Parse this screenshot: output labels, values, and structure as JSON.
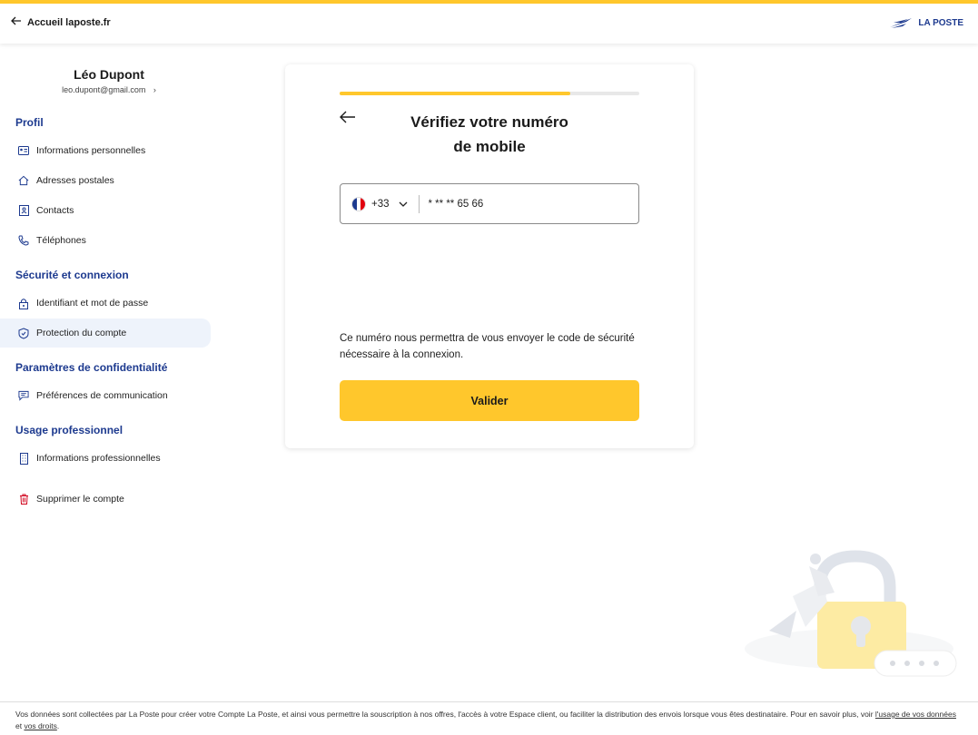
{
  "header": {
    "back_label": "Accueil laposte.fr",
    "logo_text": "LA POSTE",
    "accent_color": "#ffc72c",
    "brand_color": "#1d3a8f"
  },
  "user": {
    "name": "Léo Dupont",
    "email": "leo.dupont@gmail.com",
    "chevron": "›"
  },
  "sidebar": {
    "sections": [
      {
        "title": "Profil",
        "items": [
          {
            "label": "Informations personnelles",
            "icon": "id-card-icon"
          },
          {
            "label": "Adresses postales",
            "icon": "home-icon"
          },
          {
            "label": "Contacts",
            "icon": "contacts-icon"
          },
          {
            "label": "Téléphones",
            "icon": "phone-icon"
          }
        ]
      },
      {
        "title": "Sécurité et connexion",
        "items": [
          {
            "label": "Identifiant et mot de passe",
            "icon": "lock-icon"
          },
          {
            "label": "Protection du compte",
            "icon": "shield-icon",
            "active": true
          }
        ]
      },
      {
        "title": "Paramètres de confidentialité",
        "items": [
          {
            "label": "Préférences de communication",
            "icon": "message-icon"
          }
        ]
      },
      {
        "title": "Usage professionnel",
        "items": [
          {
            "label": "Informations professionnelles",
            "icon": "building-icon"
          }
        ]
      }
    ],
    "delete_label": "Supprimer le compte"
  },
  "card": {
    "progress": 0.77,
    "title_line1": "Vérifiez votre numéro",
    "title_line2": "de mobile",
    "country_code": "+33",
    "phone_value": "* ** ** 65 66",
    "description": "Ce numéro nous permettra de vous envoyer le code de sécurité nécessaire à la connexion.",
    "submit_label": "Valider"
  },
  "footer": {
    "text": "Vos données sont collectées par La Poste pour créer votre Compte La Poste, et ainsi vous permettre la souscription à nos offres, l'accès à votre Espace client, ou faciliter la distribution des envois lorsque vous êtes destinataire. Pour en savoir plus, voir ",
    "link1": "l'usage de vos données",
    "middle": " et ",
    "link2": "vos droits",
    "end": "."
  }
}
